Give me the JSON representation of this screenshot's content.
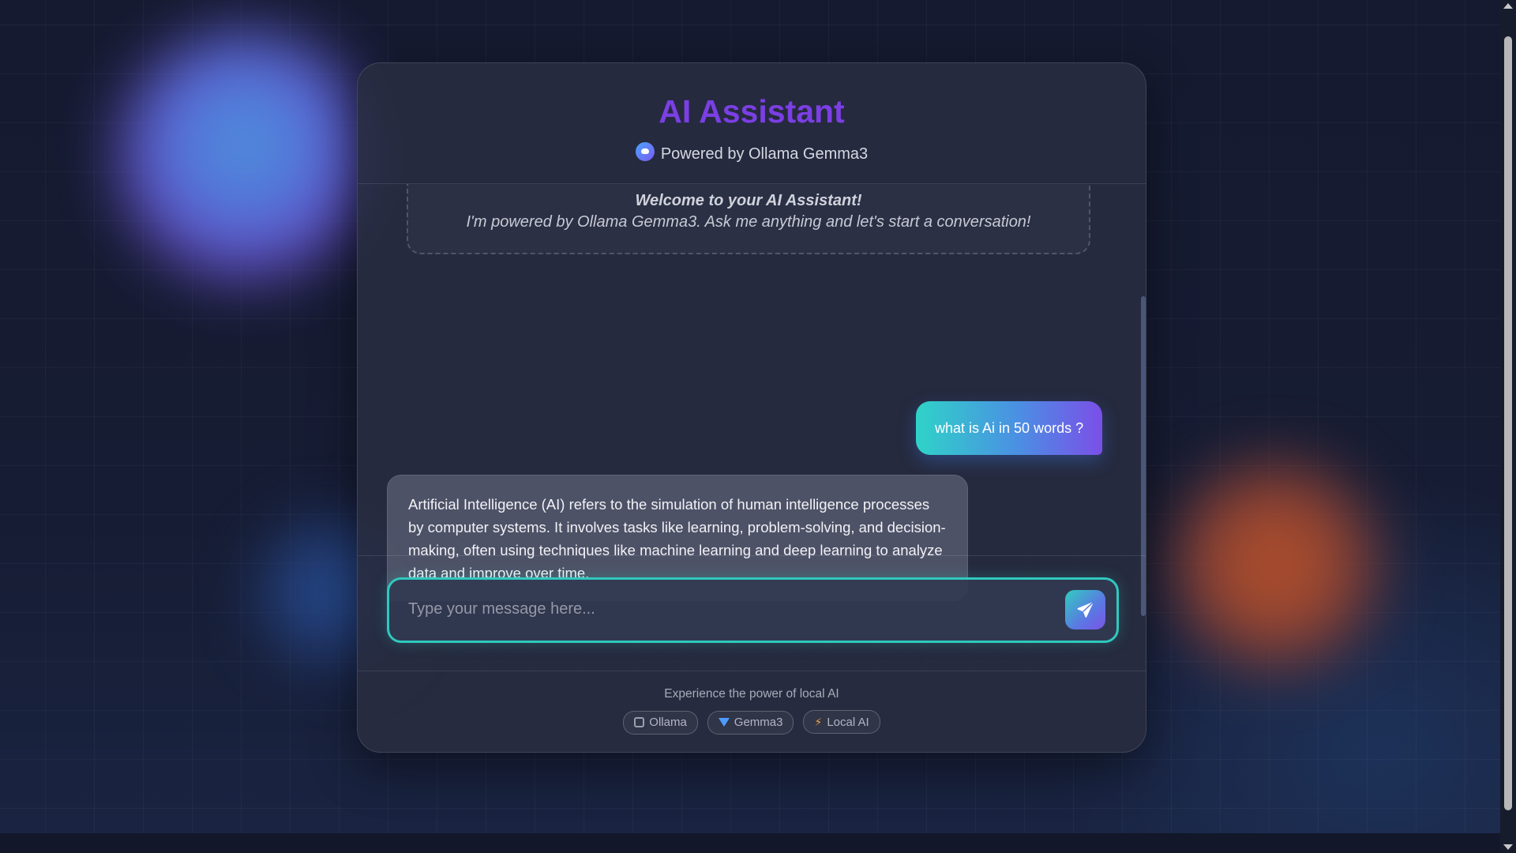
{
  "header": {
    "title": "AI Assistant",
    "subtitle": "Powered by Ollama Gemma3"
  },
  "welcome": {
    "title": "Welcome to your AI Assistant!",
    "text": "I'm powered by Ollama Gemma3. Ask me anything and let's start a conversation!"
  },
  "messages": [
    {
      "role": "user",
      "text": "what is Ai in 50 words ?"
    },
    {
      "role": "assistant",
      "text": "Artificial Intelligence (AI) refers to the simulation of human intelligence processes by computer systems. It involves tasks like learning, problem-solving, and decision-making, often using techniques like machine learning and deep learning to analyze data and improve over time."
    }
  ],
  "input": {
    "placeholder": "Type your message here...",
    "value": ""
  },
  "footer": {
    "tagline": "Experience the power of local AI",
    "badges": [
      {
        "label": "Ollama",
        "icon": "robot-icon"
      },
      {
        "label": "Gemma3",
        "icon": "gem-icon"
      },
      {
        "label": "Local AI",
        "icon": "bolt-icon"
      }
    ]
  },
  "colors": {
    "title": "#7b3fe4",
    "input_border": "#2fc9bd",
    "user_bubble_start": "#2fd3c8",
    "user_bubble_end": "#7b4fe8"
  }
}
